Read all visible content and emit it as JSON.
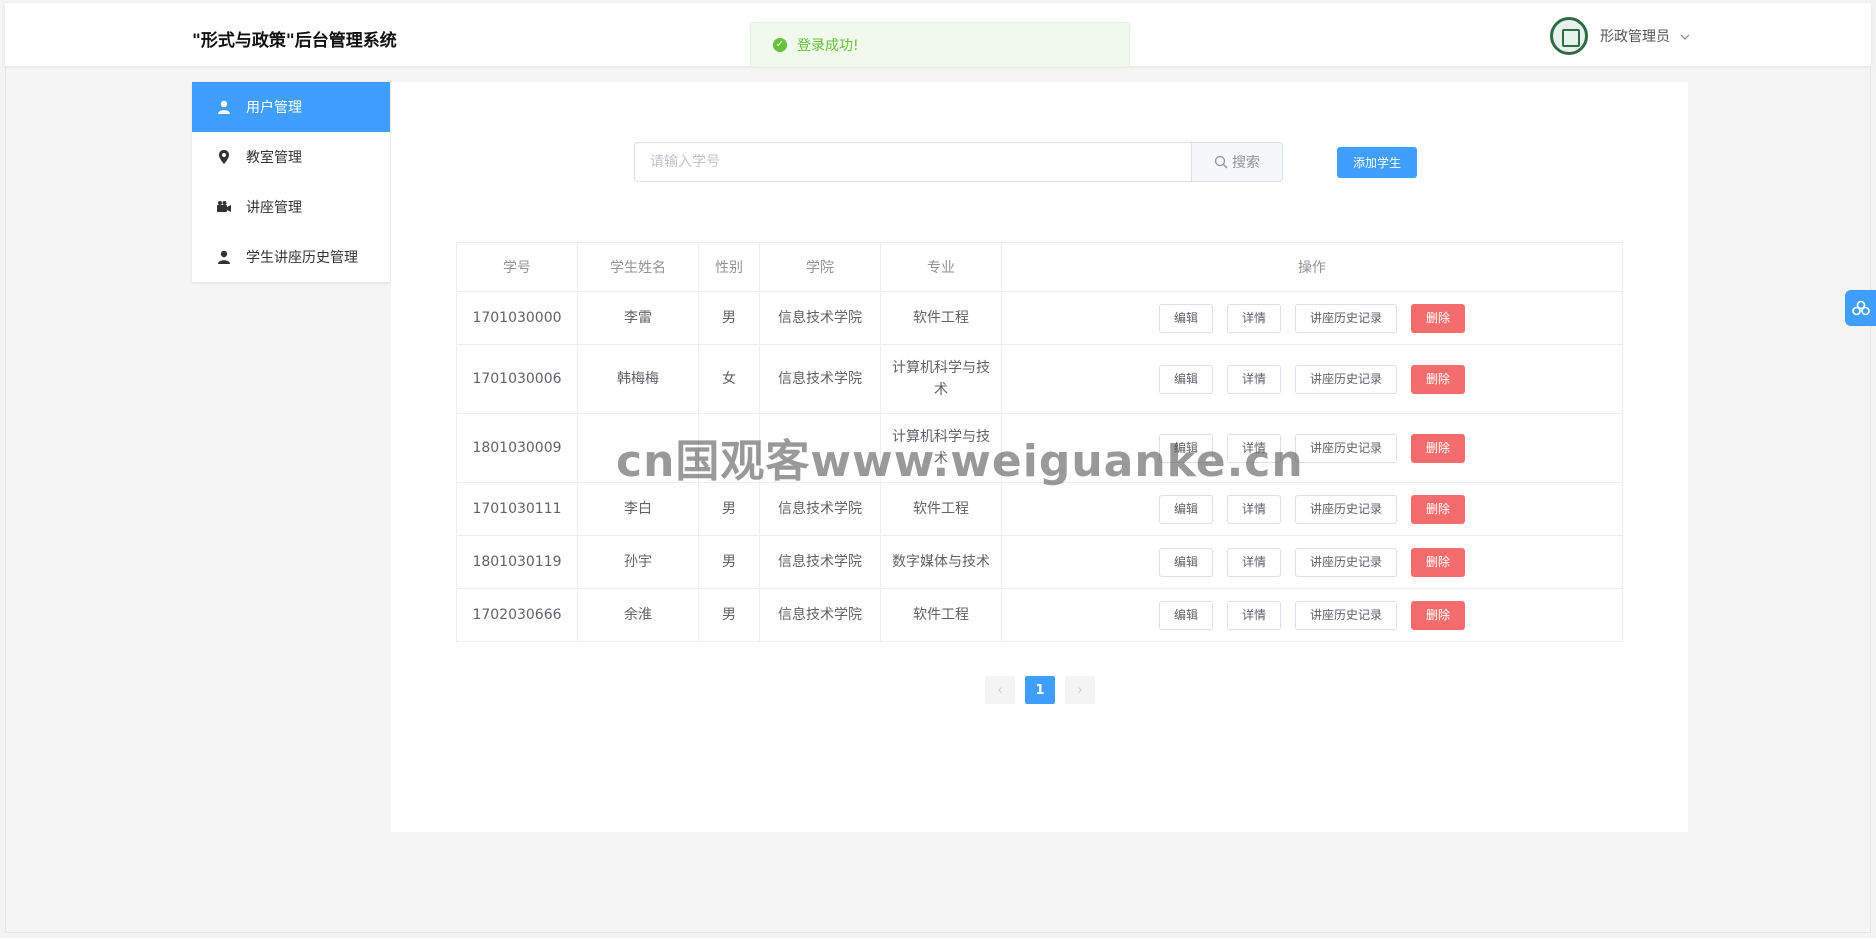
{
  "app": {
    "title": "\"形式与政策\"后台管理系统"
  },
  "user": {
    "name": "形政管理员",
    "caret": "⌄"
  },
  "toast": {
    "text": "登录成功!"
  },
  "sidebar": {
    "items": [
      {
        "label": "用户管理",
        "icon": "user-icon",
        "active": true
      },
      {
        "label": "教室管理",
        "icon": "location-icon",
        "active": false
      },
      {
        "label": "讲座管理",
        "icon": "camera-icon",
        "active": false
      },
      {
        "label": "学生讲座历史管理",
        "icon": "user-icon",
        "active": false
      }
    ]
  },
  "search": {
    "placeholder": "请输入学号",
    "button_label": "搜索"
  },
  "add_button": {
    "label": "添加学生"
  },
  "table": {
    "headers": [
      "学号",
      "学生姓名",
      "性别",
      "学院",
      "专业",
      "操作"
    ],
    "actions": [
      "编辑",
      "详情",
      "讲座历史记录",
      "删除"
    ],
    "rows": [
      {
        "id": "1701030000",
        "name": "李雷",
        "gender": "男",
        "college": "信息技术学院",
        "major": "软件工程"
      },
      {
        "id": "1701030006",
        "name": "韩梅梅",
        "gender": "女",
        "college": "信息技术学院",
        "major": "计算机科学与技术"
      },
      {
        "id": "1801030009",
        "name": "",
        "gender": "",
        "college": "",
        "major": "计算机科学与技术"
      },
      {
        "id": "1701030111",
        "name": "李白",
        "gender": "男",
        "college": "信息技术学院",
        "major": "软件工程"
      },
      {
        "id": "1801030119",
        "name": "孙宇",
        "gender": "男",
        "college": "信息技术学院",
        "major": "数字媒体与技术"
      },
      {
        "id": "1702030666",
        "name": "余淮",
        "gender": "男",
        "college": "信息技术学院",
        "major": "软件工程"
      }
    ]
  },
  "pagination": {
    "prev": "‹",
    "current": "1",
    "next": "›"
  },
  "watermark": "cn国观客www.weiguanke.cn",
  "colors": {
    "primary": "#409eff",
    "danger": "#f56c6c",
    "success": "#67c23a"
  }
}
